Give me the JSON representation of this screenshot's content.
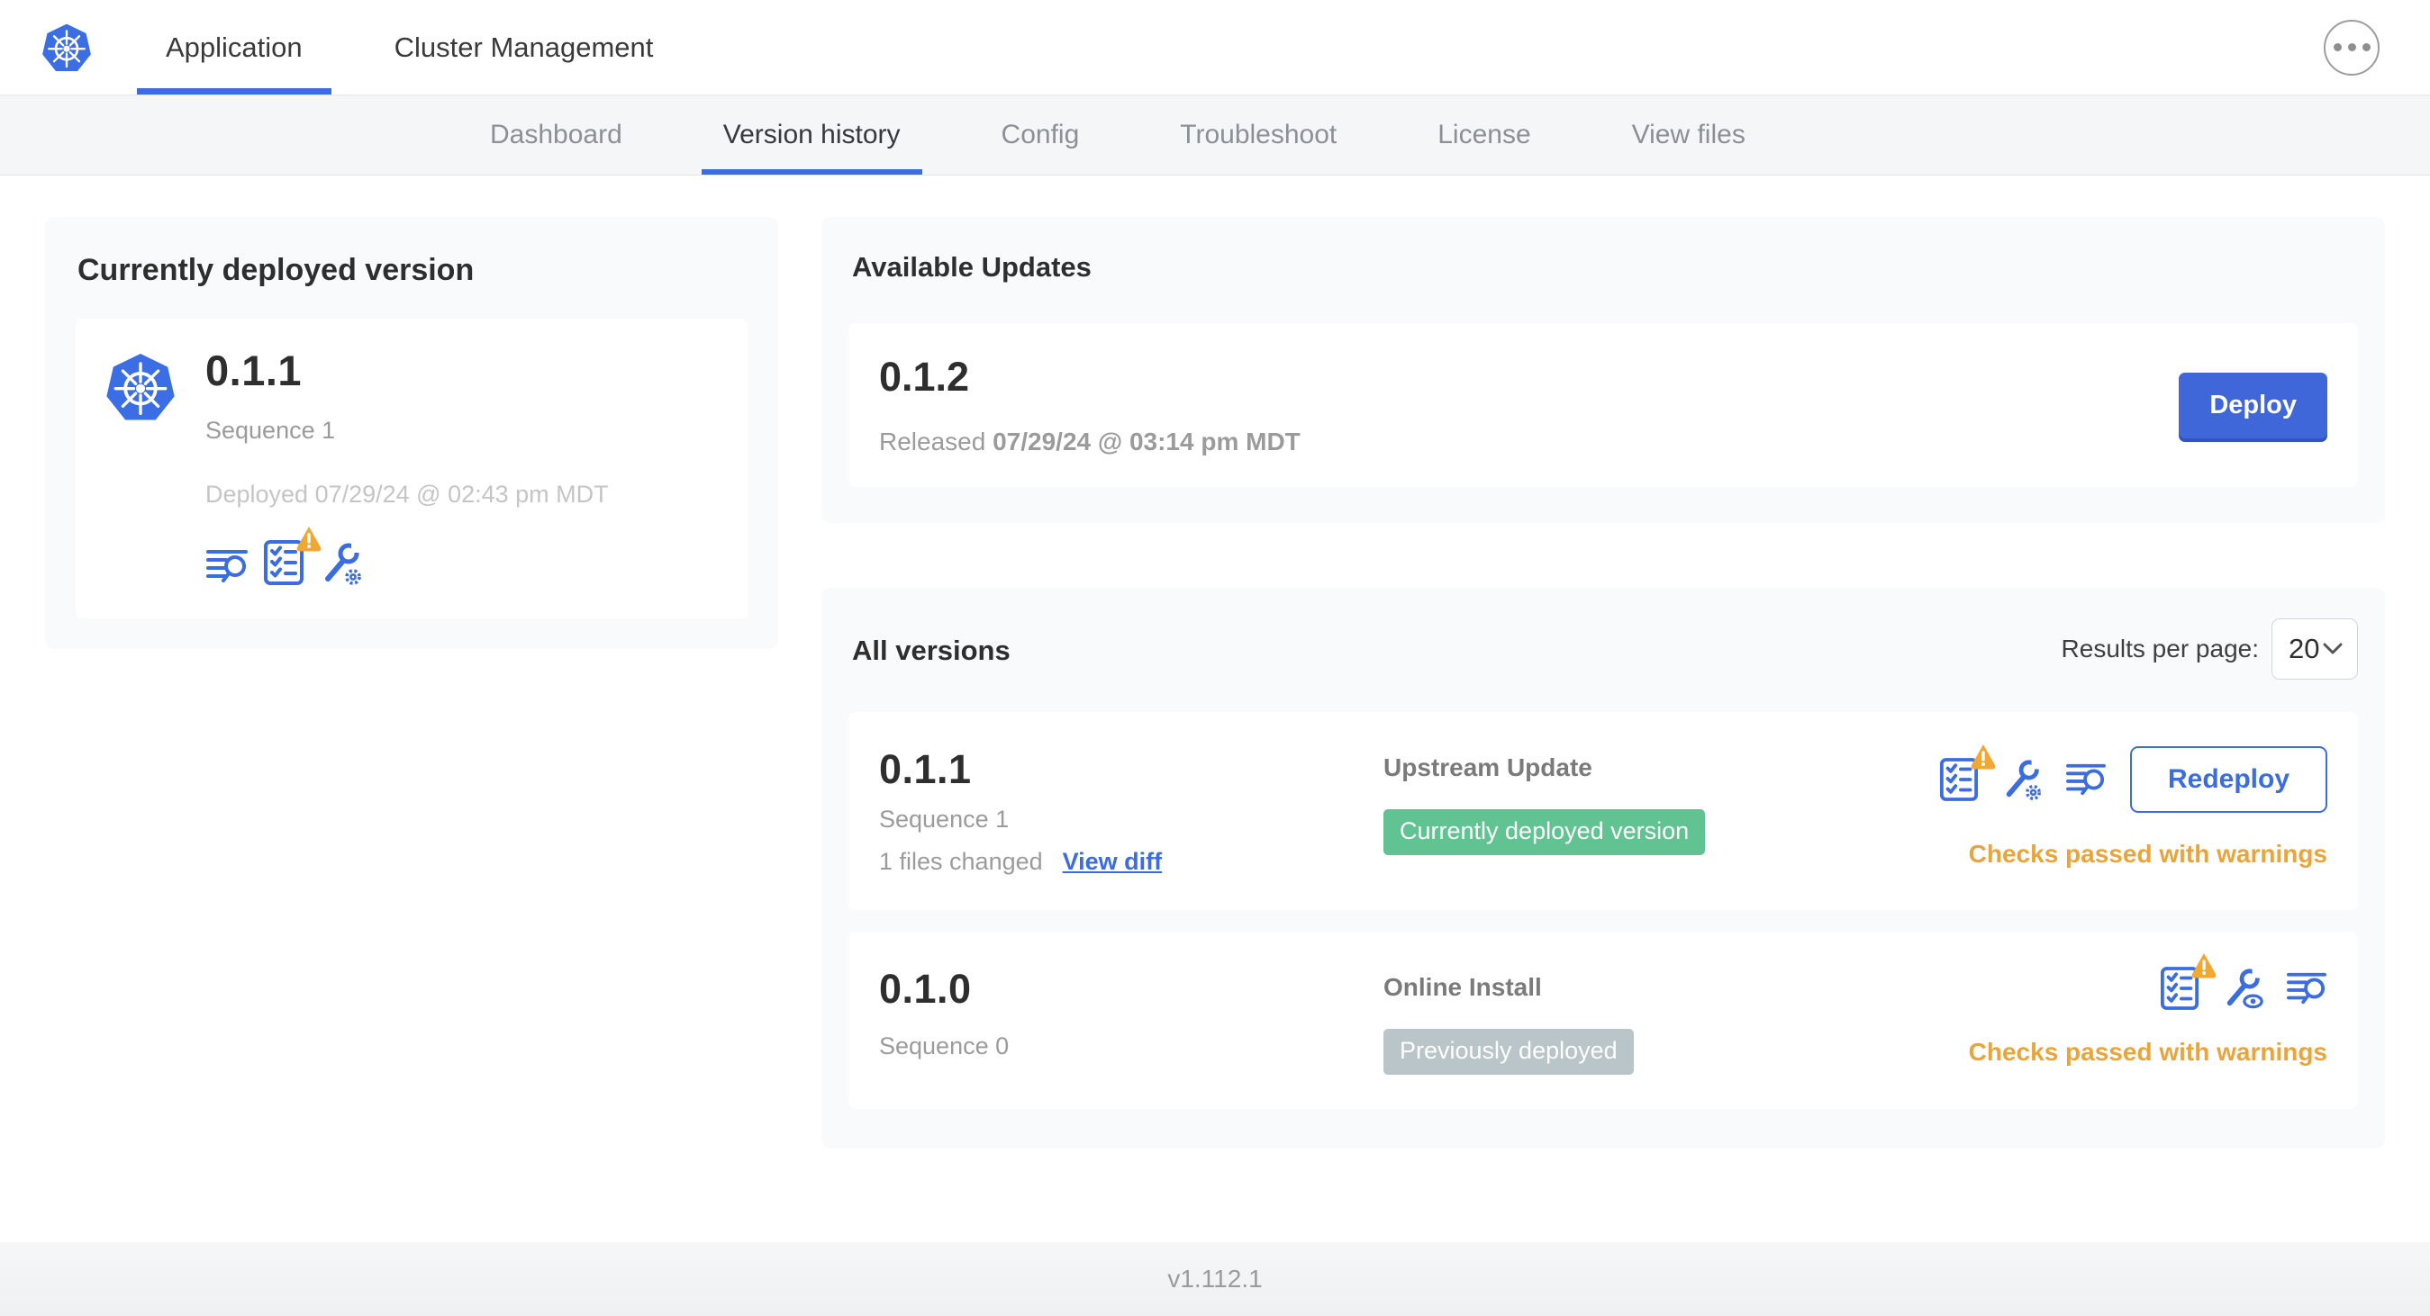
{
  "colors": {
    "accent_blue": "#3b6ce0",
    "deploy_button": "#4067da",
    "badge_green": "#61c392",
    "badge_gray": "#b9c5c9",
    "warning_orange": "#e9a53c",
    "card_bg": "#f9fafb",
    "subnav_bg": "#f4f6f8"
  },
  "header": {
    "logo_icon": "kubernetes-logo",
    "more_icon": "ellipsis",
    "tabs": [
      {
        "label": "Application",
        "active": true
      },
      {
        "label": "Cluster Management",
        "active": false
      }
    ]
  },
  "subnav": {
    "tabs": [
      {
        "label": "Dashboard",
        "active": false
      },
      {
        "label": "Version history",
        "active": true
      },
      {
        "label": "Config",
        "active": false
      },
      {
        "label": "Troubleshoot",
        "active": false
      },
      {
        "label": "License",
        "active": false
      },
      {
        "label": "View files",
        "active": false
      }
    ]
  },
  "current_version_card": {
    "title": "Currently deployed version",
    "app_icon": "kubernetes-logo",
    "version": "0.1.1",
    "sequence": "Sequence 1",
    "deployed": "Deployed 07/29/24 @ 02:43 pm MDT",
    "icons": [
      "release-notes-icon",
      "preflight-checks-warning-icon",
      "edit-config-icon"
    ]
  },
  "available_updates": {
    "title": "Available Updates",
    "version": "0.1.2",
    "released_label": "Released",
    "released_date": "07/29/24 @ 03:14 pm MDT",
    "deploy_label": "Deploy"
  },
  "all_versions": {
    "title": "All versions",
    "results_per_page_label": "Results per page:",
    "results_per_page_value": "20",
    "rows": [
      {
        "version": "0.1.1",
        "sequence": "Sequence 1",
        "files_changed": "1 files changed",
        "view_diff_label": "View diff",
        "source": "Upstream Update",
        "badge": {
          "label": "Currently deployed version",
          "type": "green"
        },
        "icons": [
          "preflight-checks-warning-icon",
          "edit-config-icon",
          "release-notes-icon"
        ],
        "action_label": "Redeploy",
        "status": "Checks passed with warnings"
      },
      {
        "version": "0.1.0",
        "sequence": "Sequence 0",
        "source": "Online Install",
        "badge": {
          "label": "Previously deployed",
          "type": "gray"
        },
        "icons": [
          "preflight-checks-warning-icon",
          "view-config-icon",
          "release-notes-icon"
        ],
        "status": "Checks passed with warnings"
      }
    ]
  },
  "footer": {
    "version": "v1.112.1"
  }
}
